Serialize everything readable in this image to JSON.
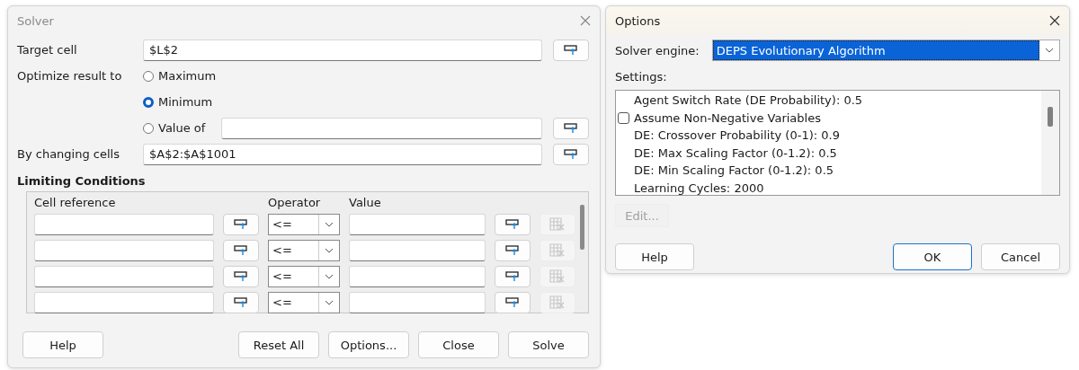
{
  "solver": {
    "title": "Solver",
    "target_cell": {
      "label": "Target cell",
      "value": "$L$2"
    },
    "optimize": {
      "label": "Optimize result to",
      "options": [
        {
          "label": "Maximum",
          "selected": false
        },
        {
          "label": "Minimum",
          "selected": true
        },
        {
          "label": "Value of",
          "selected": false
        }
      ]
    },
    "changing_cells": {
      "label": "By changing cells",
      "value": "$A$2:$A$1001"
    },
    "limiting_conditions": {
      "title": "Limiting Conditions",
      "columns": [
        "Cell reference",
        "Operator",
        "Value"
      ],
      "rows": [
        {
          "operator": "<="
        },
        {
          "operator": "<="
        },
        {
          "operator": "<="
        },
        {
          "operator": "<="
        }
      ]
    },
    "buttons": [
      "Help",
      "Reset All",
      "Options...",
      "Close",
      "Solve"
    ]
  },
  "options": {
    "title": "Options",
    "engine": {
      "label": "Solver engine:",
      "value": "DEPS Evolutionary Algorithm"
    },
    "settings_label": "Settings:",
    "settings": [
      {
        "kind": "value",
        "label": "Agent Switch Rate (DE Probability): 0.5"
      },
      {
        "kind": "checkbox",
        "label": "Assume Non-Negative Variables",
        "checked": false
      },
      {
        "kind": "value",
        "label": "DE: Crossover Probability (0-1): 0.9"
      },
      {
        "kind": "value",
        "label": "DE: Max Scaling Factor (0-1.2): 0.5"
      },
      {
        "kind": "value",
        "label": "DE: Min Scaling Factor (0-1.2): 0.5"
      },
      {
        "kind": "value",
        "label": "Learning Cycles: 2000"
      }
    ],
    "edit_button": {
      "label": "Edit...",
      "disabled": true
    },
    "buttons": [
      {
        "label": "Help",
        "default": false
      },
      {
        "label": "OK",
        "default": true
      },
      {
        "label": "Cancel",
        "default": false
      }
    ]
  }
}
